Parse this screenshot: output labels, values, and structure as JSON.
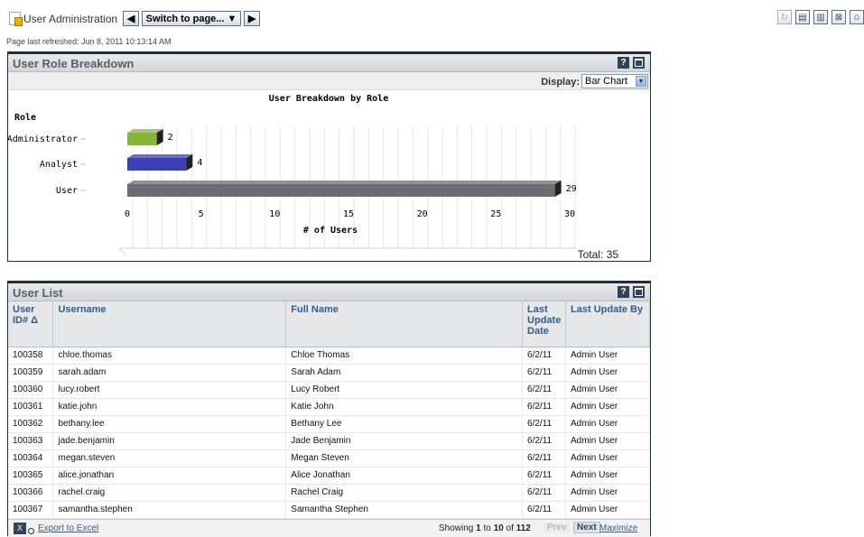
{
  "header": {
    "title": "User Administration",
    "switch_label": "Switch to page... ▼",
    "prev_arrow": "◀",
    "next_arrow": "▶",
    "right_icons": [
      "refresh-icon",
      "document-icon",
      "print-icon",
      "pdf-icon",
      "user-icon"
    ]
  },
  "refresh_text": "Page last refreshed: Jun 8, 2011 10:13:14 AM",
  "role_breakdown": {
    "title": "User Role Breakdown",
    "help_icon": "?",
    "display_label": "Display:",
    "display_value": "Bar Chart",
    "total_text": "Total: 35"
  },
  "chart_data": {
    "type": "bar",
    "orientation": "horizontal",
    "title": "User Breakdown by Role",
    "ylabel": "Role",
    "xlabel": "# of Users",
    "categories": [
      "Administrator",
      "Analyst",
      "User"
    ],
    "values": [
      2,
      4,
      29
    ],
    "colors": [
      "#86b53a",
      "#3b3fb5",
      "#6a6e73"
    ],
    "xlim": [
      0,
      30
    ],
    "xticks": [
      "0",
      "5",
      "10",
      "15",
      "20",
      "25",
      "30"
    ],
    "grid": true,
    "style": "3d"
  },
  "user_list": {
    "title": "User List",
    "help_icon": "?",
    "columns": [
      "User ID# Δ",
      "Username",
      "Full Name",
      "Last Update Date",
      "Last Update By"
    ],
    "rows": [
      [
        "100358",
        "chloe.thomas",
        "Chloe Thomas",
        "6/2/11",
        "Admin User"
      ],
      [
        "100359",
        "sarah.adam",
        "Sarah Adam",
        "6/2/11",
        "Admin User"
      ],
      [
        "100360",
        "lucy.robert",
        "Lucy Robert",
        "6/2/11",
        "Admin User"
      ],
      [
        "100361",
        "katie.john",
        "Katie John",
        "6/2/11",
        "Admin User"
      ],
      [
        "100362",
        "bethany.lee",
        "Bethany Lee",
        "6/2/11",
        "Admin User"
      ],
      [
        "100363",
        "jade.benjamin",
        "Jade Benjamin",
        "6/2/11",
        "Admin User"
      ],
      [
        "100364",
        "megan.steven",
        "Megan Steven",
        "6/2/11",
        "Admin User"
      ],
      [
        "100365",
        "alice.jonathan",
        "Alice Jonathan",
        "6/2/11",
        "Admin User"
      ],
      [
        "100366",
        "rachel.craig",
        "Rachel Craig",
        "6/2/11",
        "Admin User"
      ],
      [
        "100367",
        "samantha.stephen",
        "Samantha Stephen",
        "6/2/11",
        "Admin User"
      ]
    ],
    "export_label": "Export to Excel",
    "showing_prefix": "Showing",
    "showing_from": "1",
    "showing_to_word": "to",
    "showing_to": "10",
    "showing_of_word": "of",
    "showing_total": "112",
    "prev_label": "Prev",
    "next_label": "Next",
    "maximize_label": "Maximize"
  }
}
